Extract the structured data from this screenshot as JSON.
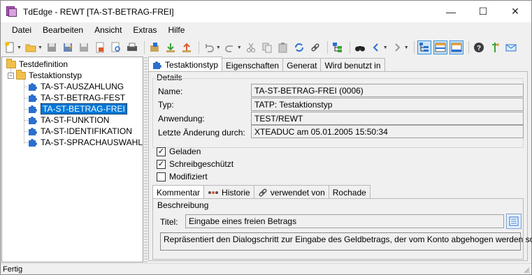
{
  "window": {
    "title": "TdEdge - REWT [TA-ST-BETRAG-FREI]",
    "controls": {
      "minimize": "—",
      "maximize": "☐",
      "close": "✕"
    }
  },
  "menu": [
    "Datei",
    "Bearbeiten",
    "Ansicht",
    "Extras",
    "Hilfe"
  ],
  "toolbar": {
    "icons": [
      "new-icon",
      "open-folder-icon",
      "save-icon",
      "save-as-icon",
      "save-all-icon",
      "export-icon",
      "preview-icon",
      "print-icon",
      "package-icon",
      "download-icon",
      "upload-icon",
      "undo-icon",
      "redo-icon",
      "cut-icon",
      "copy-icon",
      "paste-icon",
      "refresh-icon",
      "link-icon",
      "hierarchy-icon",
      "binoculars-icon",
      "back-icon",
      "forward-icon",
      "layout-tree-icon",
      "layout-split-icon",
      "layout-bottom-icon",
      "help-icon",
      "pin-icon",
      "mail-icon"
    ]
  },
  "tree": {
    "root": "Testdefinition",
    "group": "Testaktionstyp",
    "items": [
      "TA-ST-AUSZAHLUNG",
      "TA-ST-BETRAG-FEST",
      "TA-ST-BETRAG-FREI",
      "TA-ST-FUNKTION",
      "TA-ST-IDENTIFIKATION",
      "TA-ST-SPRACHAUSWAHL"
    ],
    "selected": "TA-ST-BETRAG-FREI"
  },
  "tabs": [
    "Testaktionstyp",
    "Eigenschaften",
    "Generat",
    "Wird benutzt in"
  ],
  "details": {
    "group_title": "Details",
    "name_label": "Name:",
    "name_value": "TA-ST-BETRAG-FREI (0006)",
    "typ_label": "Typ:",
    "typ_value": "TATP: Testaktionstyp",
    "anwendung_label": "Anwendung:",
    "anwendung_value": "TEST/REWT",
    "change_label": "Letzte Änderung durch:",
    "change_value": "XTEADUC am 05.01.2005 15:50:34"
  },
  "checkboxes": [
    {
      "label": "Geladen",
      "checked": true,
      "mark": "✓"
    },
    {
      "label": "Schreibgeschützt",
      "checked": true,
      "mark": "✓"
    },
    {
      "label": "Modifiziert",
      "checked": false,
      "mark": ""
    }
  ],
  "subtabs": [
    "Kommentar",
    "Historie",
    "verwendet von",
    "Rochade"
  ],
  "kommentar": {
    "group_title": "Beschreibung",
    "title_label": "Titel:",
    "title_value": "Eingabe eines freien Betrags",
    "description": "Repräsentiert den Dialogschritt zur Eingabe des Geldbetrags, der vom Konto abgehogen werden soll."
  },
  "status": "Fertig",
  "colors": {
    "selection": "#0078d7",
    "folder": "#f2c04a",
    "puzzle": "#2b6fcf"
  }
}
